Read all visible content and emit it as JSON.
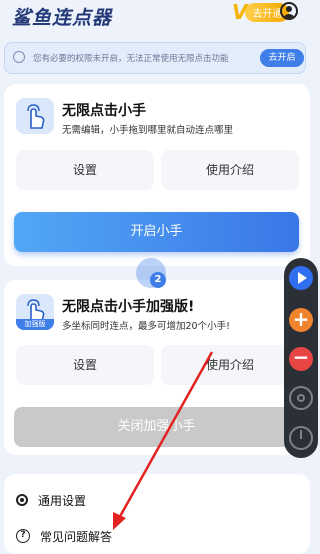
{
  "app": {
    "title": "鲨鱼连点器",
    "vip_letter": "V",
    "vip_button": "去开通"
  },
  "notice": {
    "text": "您有必要的权限未开启，无法正常使用无限点击功能",
    "button": "去开启"
  },
  "feature_basic": {
    "title": "无限点击小手",
    "description": "无需编辑，小手拖到哪里就自动连点哪里",
    "settings_label": "设置",
    "intro_label": "使用介绍",
    "start_label": "开启小手"
  },
  "feature_pro": {
    "title": "无限点击小手加强版!",
    "description": "多坐标同时连点，最多可增加20个小手!",
    "icon_tag": "加强版",
    "settings_label": "设置",
    "intro_label": "使用介绍",
    "close_label": "关闭加强小手"
  },
  "settings_list": {
    "general": "通用设置",
    "faq": "常见问题解答"
  },
  "cursor": {
    "number": "2"
  },
  "float_toolbar": {
    "plus": "+",
    "minus": "−"
  },
  "colors": {
    "accent": "#3f7ee8",
    "vip": "#f6a800",
    "arrow": "#e52222"
  },
  "icons": [
    "tap-hand-icon",
    "user-icon",
    "lightbulb-icon",
    "gear-icon",
    "question-icon",
    "play-icon",
    "power-icon"
  ]
}
